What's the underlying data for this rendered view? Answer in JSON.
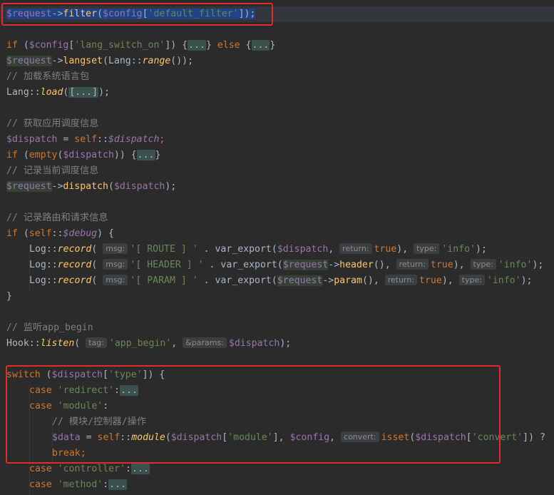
{
  "code": {
    "l1": {
      "var": "$request",
      "arrow": "->",
      "fn": "filter",
      "p1": "(",
      "var2": "$config",
      "b1": "[",
      "str": "'default_filter'",
      "b2": "]",
      "end": ");"
    },
    "l2": {
      "kw": "if",
      "p1": " (",
      "var": "$config",
      "b1": "[",
      "str": "'lang_switch_on'",
      "b2": "])",
      "sp": " {",
      "fold1": "...",
      "p2": "} ",
      "kw2": "else",
      "p3": " {",
      "fold2": "...",
      "p4": "}"
    },
    "l3": {
      "var": "$request",
      "arrow": "->",
      "fn": "langset",
      "p1": "(Lang::",
      "fn2": "range",
      "end": "());"
    },
    "l4": {
      "cm": "// 加载系统语言包"
    },
    "l5": {
      "cls": "Lang::",
      "fn": "load",
      "p1": "(",
      "fold": "[...]",
      "end": ");"
    },
    "l6": {
      "cm": "// 获取应用调度信息"
    },
    "l7": {
      "var": "$dispatch",
      "eq": " = ",
      "kw": "self",
      "p1": "::",
      "var2": "$dispatch",
      "end": ";"
    },
    "l8": {
      "kw": "if",
      "p1": " (",
      "fn": "empty",
      "p2": "(",
      "var": "$dispatch",
      "p3": ")) {",
      "fold": "...",
      "end": "}"
    },
    "l9": {
      "cm": "// 记录当前调度信息"
    },
    "l10": {
      "var": "$request",
      "arrow": "->",
      "fn": "dispatch",
      "p1": "(",
      "var2": "$dispatch",
      "end": ");"
    },
    "l11": {
      "cm": "// 记录路由和请求信息"
    },
    "l12": {
      "kw": "if",
      "p1": " (",
      "kw2": "self",
      "p2": "::",
      "var": "$debug",
      "end": ") {"
    },
    "l13": {
      "cls": "Log::",
      "fn": "record",
      "p1": "( ",
      "h1": "msg:",
      "str1": "'[ ROUTE ] '",
      "p2": " . var_export(",
      "var": "$dispatch",
      "p3": ", ",
      "h2": "return:",
      "kw": "true",
      "p4": "), ",
      "h3": "type:",
      "str2": "'info'",
      "end": ");"
    },
    "l14": {
      "cls": "Log::",
      "fn": "record",
      "p1": "( ",
      "h1": "msg:",
      "str1": "'[ HEADER ] '",
      "p2": " . var_export(",
      "var": "$request",
      "arrow": "->",
      "fn2": "header",
      "p3": "(), ",
      "h2": "return:",
      "kw": "true",
      "p4": "), ",
      "h3": "type:",
      "str2": "'info'",
      "end": ");"
    },
    "l15": {
      "cls": "Log::",
      "fn": "record",
      "p1": "( ",
      "h1": "msg:",
      "str1": "'[ PARAM ] '",
      "p2": " . var_export(",
      "var": "$request",
      "arrow": "->",
      "fn2": "param",
      "p3": "(), ",
      "h2": "return:",
      "kw": "true",
      "p4": "), ",
      "h3": "type:",
      "str2": "'info'",
      "end": ");"
    },
    "l16": {
      "p": "}"
    },
    "l17": {
      "cm": "// 监听app_begin"
    },
    "l18": {
      "cls": "Hook::",
      "fn": "listen",
      "p1": "( ",
      "h1": "tag:",
      "str": "'app_begin'",
      "p2": ", ",
      "h2": "&params:",
      "var": "$dispatch",
      "end": ");"
    },
    "l19": {
      "kw": "switch",
      "p1": " (",
      "var": "$dispatch",
      "b1": "[",
      "str": "'type'",
      "end": "]) {"
    },
    "l20": {
      "kw": "case",
      "sp": " ",
      "str": "'redirect'",
      "p": ":",
      "fold": "..."
    },
    "l21": {
      "kw": "case",
      "sp": " ",
      "str": "'module'",
      "p": ":"
    },
    "l22": {
      "cm": "// 模块/控制器/操作"
    },
    "l23": {
      "var": "$data",
      "eq": " = ",
      "kw": "self",
      "p1": "::",
      "fn": "module",
      "p2": "(",
      "var2": "$dispatch",
      "b1": "[",
      "str": "'module'",
      "p3": "], ",
      "var3": "$config",
      "p4": ", ",
      "h1": "convert:",
      "fn2": "isset",
      "p5": "(",
      "var4": "$dispatch",
      "b2": "[",
      "str2": "'convert'",
      "end": "]) ?"
    },
    "l24": {
      "kw": "break",
      "end": ";"
    },
    "l25": {
      "kw": "case",
      "sp": " ",
      "str": "'controller'",
      "p": ":",
      "fold": "..."
    },
    "l26": {
      "kw": "case",
      "sp": " ",
      "str": "'method'",
      "p": ":",
      "fold": "..."
    }
  }
}
